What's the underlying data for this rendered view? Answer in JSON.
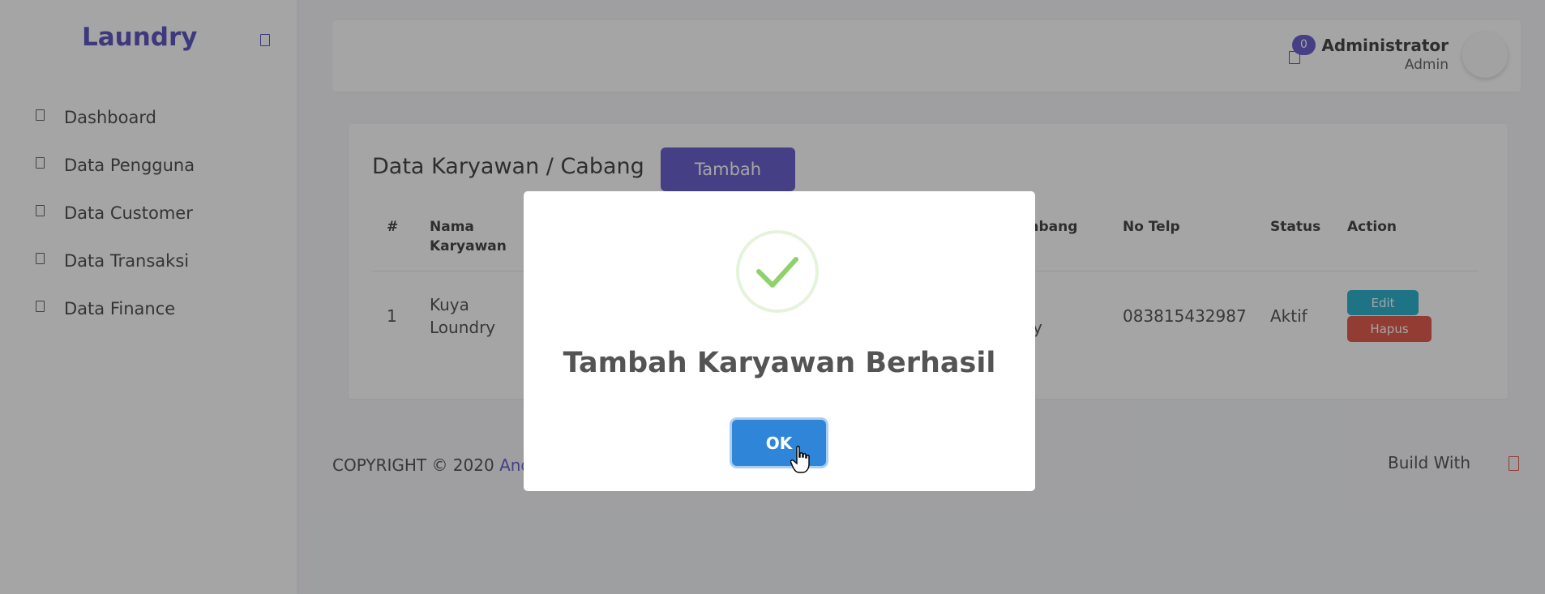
{
  "sidebar": {
    "brand": "Laundry",
    "items": [
      {
        "label": "Dashboard"
      },
      {
        "label": "Data Pengguna"
      },
      {
        "label": "Data Customer"
      },
      {
        "label": "Data Transaksi"
      },
      {
        "label": "Data Finance"
      }
    ]
  },
  "header": {
    "notification_count": "0",
    "user_name": "Administrator",
    "user_role": "Admin"
  },
  "card": {
    "title": "Data Karyawan / Cabang",
    "add_button": "Tambah",
    "columns": [
      "#",
      "Nama",
      "Karyawan",
      "abang",
      "No Telp",
      "Status",
      "Action"
    ],
    "rows": [
      {
        "no": "1",
        "nama_line1": "Kuya",
        "nama_line2": "Loundry",
        "cabang_partial": "y",
        "telp": "083815432987",
        "status": "Aktif",
        "edit_label": "Edit",
        "delete_label": "Hapus"
      }
    ]
  },
  "footer": {
    "copyright": "COPYRIGHT © 2020 ",
    "link": "And",
    "build": "Build With"
  },
  "modal": {
    "title": "Tambah Karyawan Berhasil",
    "ok_label": "OK"
  },
  "colors": {
    "primary": "#5b52c9",
    "info": "#17a9c9",
    "danger": "#e04a3c",
    "ok": "#2f86d8",
    "success": "#8fd16a"
  },
  "icons": [
    "toggle-icon",
    "menu-item-icon",
    "notification-icon",
    "heart-icon",
    "success-check-icon",
    "hand-cursor-icon"
  ]
}
